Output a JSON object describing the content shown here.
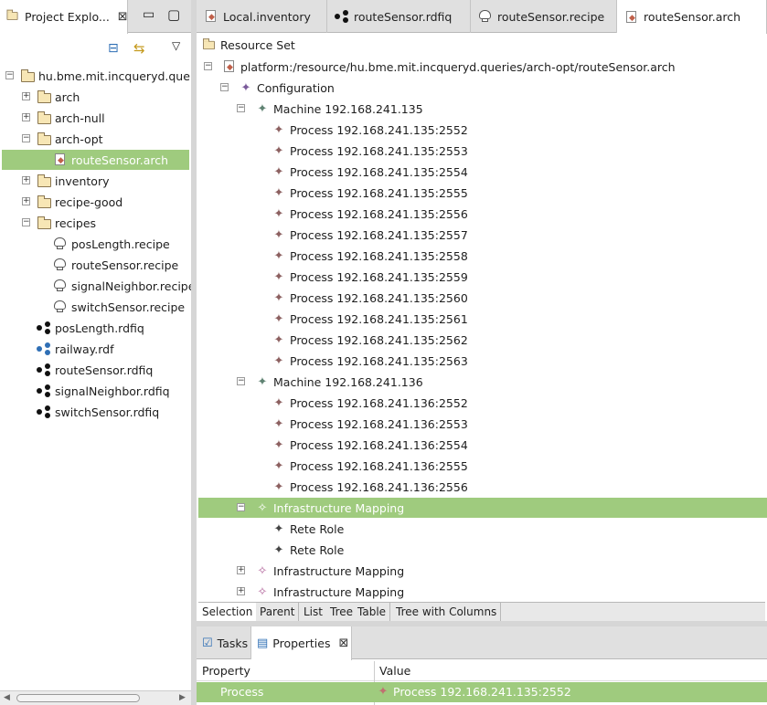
{
  "explorer": {
    "title": "Project Explo...",
    "close": "⊠",
    "min_btn": "▭",
    "max_btn": "▢",
    "collapse_btn": "⊟",
    "link_btn": "⇆",
    "menu_btn": "▽",
    "items": [
      {
        "label": "hu.bme.mit.incqueryd.quer",
        "type": "project",
        "level": 0,
        "toggle": "−"
      },
      {
        "label": "arch",
        "type": "folder",
        "level": 1,
        "toggle": "+"
      },
      {
        "label": "arch-null",
        "type": "folder",
        "level": 1,
        "toggle": "+"
      },
      {
        "label": "arch-opt",
        "type": "folder",
        "level": 1,
        "toggle": "−"
      },
      {
        "label": "routeSensor.arch",
        "type": "arch",
        "level": 2,
        "toggle": "",
        "selected": true
      },
      {
        "label": "inventory",
        "type": "folder",
        "level": 1,
        "toggle": "+"
      },
      {
        "label": "recipe-good",
        "type": "folder",
        "level": 1,
        "toggle": "+"
      },
      {
        "label": "recipes",
        "type": "folder",
        "level": 1,
        "toggle": "−"
      },
      {
        "label": "posLength.recipe",
        "type": "recipe",
        "level": 2,
        "toggle": ""
      },
      {
        "label": "routeSensor.recipe",
        "type": "recipe",
        "level": 2,
        "toggle": ""
      },
      {
        "label": "signalNeighbor.recipe",
        "type": "recipe",
        "level": 2,
        "toggle": ""
      },
      {
        "label": "switchSensor.recipe",
        "type": "recipe",
        "level": 2,
        "toggle": ""
      },
      {
        "label": "posLength.rdfiq",
        "type": "rdfiq",
        "level": 1,
        "toggle": ""
      },
      {
        "label": "railway.rdf",
        "type": "rdf",
        "level": 1,
        "toggle": ""
      },
      {
        "label": "routeSensor.rdfiq",
        "type": "rdfiq",
        "level": 1,
        "toggle": ""
      },
      {
        "label": "signalNeighbor.rdfiq",
        "type": "rdfiq",
        "level": 1,
        "toggle": ""
      },
      {
        "label": "switchSensor.rdfiq",
        "type": "rdfiq",
        "level": 1,
        "toggle": ""
      }
    ],
    "hscroll_left": "◀",
    "hscroll_right": "▶"
  },
  "editor": {
    "tabs": [
      {
        "label": "Local.inventory",
        "icon": "arch-file-icon",
        "active": false
      },
      {
        "label": "routeSensor.rdfiq",
        "icon": "graph-icon",
        "active": false
      },
      {
        "label": "routeSensor.recipe",
        "icon": "recipe-icon",
        "active": false
      },
      {
        "label": "routeSensor.arch",
        "icon": "arch-file-icon",
        "active": true
      }
    ],
    "resource_set": "Resource Set",
    "tree": [
      {
        "label": "platform:/resource/hu.bme.mit.incqueryd.queries/arch-opt/routeSensor.arch",
        "level": 0,
        "toggle": "−",
        "kind": "file"
      },
      {
        "label": "Configuration",
        "level": 1,
        "toggle": "−",
        "kind": "conf"
      },
      {
        "label": "Machine 192.168.241.135",
        "level": 2,
        "toggle": "−",
        "kind": "mach"
      },
      {
        "label": "Process 192.168.241.135:2552",
        "level": 3,
        "toggle": "",
        "kind": "proc"
      },
      {
        "label": "Process 192.168.241.135:2553",
        "level": 3,
        "toggle": "",
        "kind": "proc"
      },
      {
        "label": "Process 192.168.241.135:2554",
        "level": 3,
        "toggle": "",
        "kind": "proc"
      },
      {
        "label": "Process 192.168.241.135:2555",
        "level": 3,
        "toggle": "",
        "kind": "proc"
      },
      {
        "label": "Process 192.168.241.135:2556",
        "level": 3,
        "toggle": "",
        "kind": "proc"
      },
      {
        "label": "Process 192.168.241.135:2557",
        "level": 3,
        "toggle": "",
        "kind": "proc"
      },
      {
        "label": "Process 192.168.241.135:2558",
        "level": 3,
        "toggle": "",
        "kind": "proc"
      },
      {
        "label": "Process 192.168.241.135:2559",
        "level": 3,
        "toggle": "",
        "kind": "proc"
      },
      {
        "label": "Process 192.168.241.135:2560",
        "level": 3,
        "toggle": "",
        "kind": "proc"
      },
      {
        "label": "Process 192.168.241.135:2561",
        "level": 3,
        "toggle": "",
        "kind": "proc"
      },
      {
        "label": "Process 192.168.241.135:2562",
        "level": 3,
        "toggle": "",
        "kind": "proc"
      },
      {
        "label": "Process 192.168.241.135:2563",
        "level": 3,
        "toggle": "",
        "kind": "proc"
      },
      {
        "label": "Machine 192.168.241.136",
        "level": 2,
        "toggle": "−",
        "kind": "mach"
      },
      {
        "label": "Process 192.168.241.136:2552",
        "level": 3,
        "toggle": "",
        "kind": "proc"
      },
      {
        "label": "Process 192.168.241.136:2553",
        "level": 3,
        "toggle": "",
        "kind": "proc"
      },
      {
        "label": "Process 192.168.241.136:2554",
        "level": 3,
        "toggle": "",
        "kind": "proc"
      },
      {
        "label": "Process 192.168.241.136:2555",
        "level": 3,
        "toggle": "",
        "kind": "proc"
      },
      {
        "label": "Process 192.168.241.136:2556",
        "level": 3,
        "toggle": "",
        "kind": "proc"
      },
      {
        "label": "Infrastructure Mapping",
        "level": 2,
        "toggle": "−",
        "kind": "infra",
        "selected": true
      },
      {
        "label": "Rete Role",
        "level": 3,
        "toggle": "",
        "kind": "rete"
      },
      {
        "label": "Rete Role",
        "level": 3,
        "toggle": "",
        "kind": "rete"
      },
      {
        "label": "Infrastructure Mapping",
        "level": 2,
        "toggle": "+",
        "kind": "infra"
      },
      {
        "label": "Infrastructure Mapping",
        "level": 2,
        "toggle": "+",
        "kind": "infra"
      }
    ],
    "bottom_tabs": [
      "Selection",
      "Parent",
      "List",
      "Tree",
      "Table",
      "Tree with Columns"
    ]
  },
  "views": {
    "tasks": "Tasks",
    "properties": "Properties",
    "close": "⊠",
    "col_property": "Property",
    "col_value": "Value",
    "row": {
      "property": "Process",
      "value": "Process 192.168.241.135:2552"
    }
  },
  "colors": {
    "selection": "#9fcb7e"
  }
}
